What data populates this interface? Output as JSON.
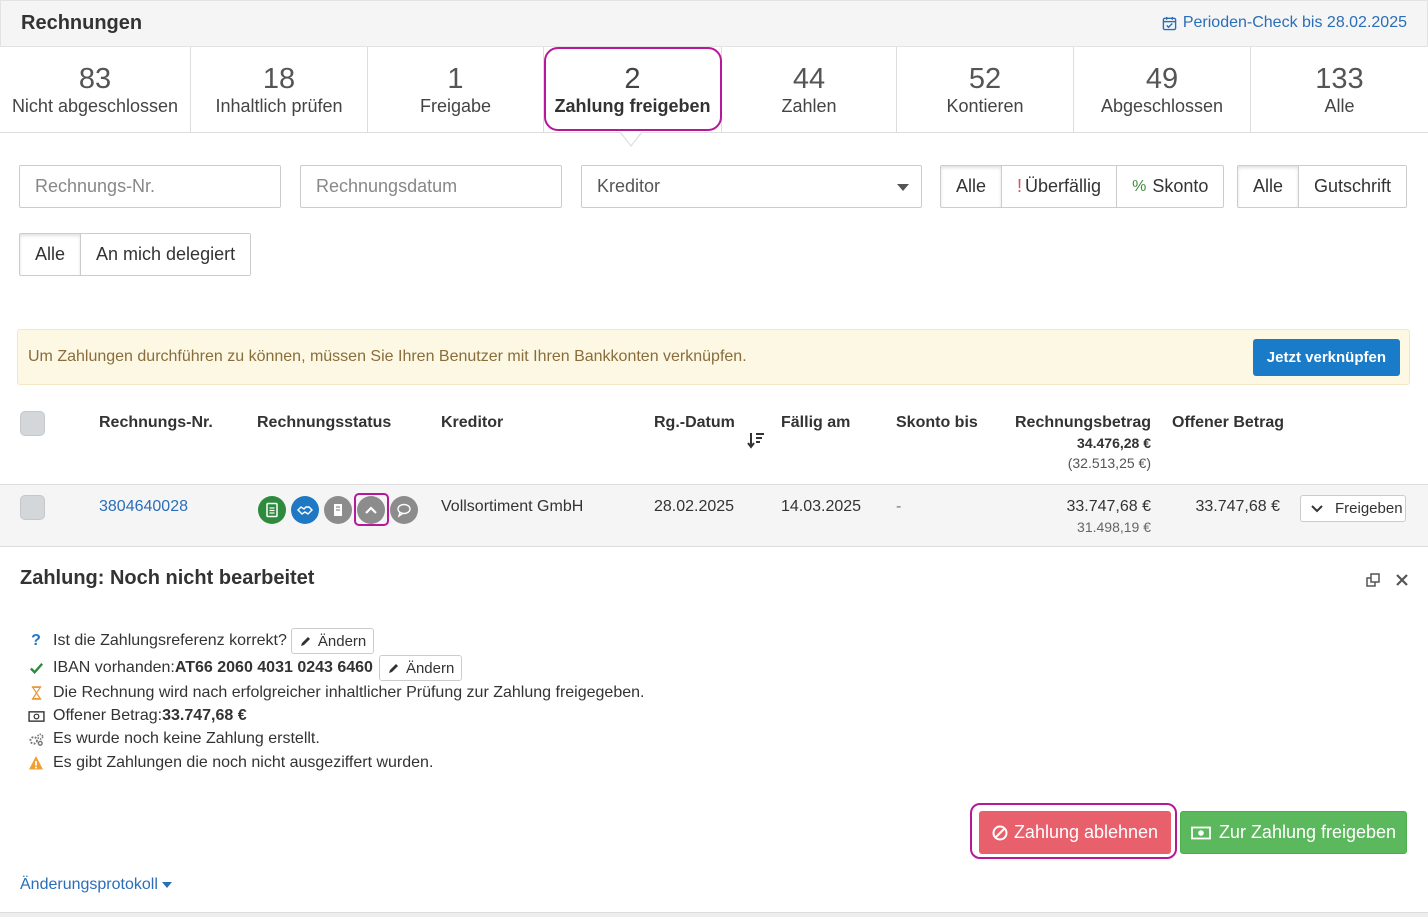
{
  "header": {
    "title": "Rechnungen",
    "period_check": "Perioden-Check bis 28.02.2025"
  },
  "tabs": [
    {
      "count": "83",
      "label": "Nicht abgeschlossen"
    },
    {
      "count": "18",
      "label": "Inhaltlich prüfen"
    },
    {
      "count": "1",
      "label": "Freigabe"
    },
    {
      "count": "2",
      "label": "Zahlung freigeben"
    },
    {
      "count": "44",
      "label": "Zahlen"
    },
    {
      "count": "52",
      "label": "Kontieren"
    },
    {
      "count": "49",
      "label": "Abgeschlossen"
    },
    {
      "count": "133",
      "label": "Alle"
    }
  ],
  "filters": {
    "invoice_no_placeholder": "Rechnungs-Nr.",
    "invoice_date_placeholder": "Rechnungsdatum",
    "creditor_select": "Kreditor",
    "due_group": [
      "Alle",
      "Überfällig",
      "Skonto"
    ],
    "type_group": [
      "Alle",
      "Gutschrift"
    ],
    "delegation_group": [
      "Alle",
      "An mich delegiert"
    ]
  },
  "alert": {
    "message": "Um Zahlungen durchführen zu können, müssen Sie Ihren Benutzer mit Ihren Bankkonten verknüpfen.",
    "button": "Jetzt verknüpfen"
  },
  "table": {
    "headers": {
      "invoice_no": "Rechnungs-Nr.",
      "status": "Rechnungsstatus",
      "creditor": "Kreditor",
      "date": "Rg.-Datum",
      "due": "Fällig am",
      "discount": "Skonto bis",
      "amount": "Rechnungsbetrag",
      "amount_total": "34.476,28 €",
      "amount_total_sub": "(32.513,25 €)",
      "open": "Offener Betrag"
    },
    "rows": [
      {
        "invoice_no": "3804640028",
        "creditor": "Vollsortiment GmbH",
        "date": "28.02.2025",
        "due": "14.03.2025",
        "discount": "-",
        "amount": "33.747,68 €",
        "amount_sub": "31.498,19 €",
        "open": "33.747,68 €",
        "action": "Freigeben"
      }
    ]
  },
  "detail": {
    "title": "Zahlung: Noch nicht bearbeitet",
    "lines": {
      "ref_question": "Ist die Zahlungsreferenz korrekt?",
      "iban_prefix": "IBAN vorhanden: ",
      "iban": "AT66 2060 4031 0243 6460",
      "pending": "Die Rechnung wird nach erfolgreicher inhaltlicher Prüfung zur Zahlung freigegeben.",
      "open_prefix": "Offener Betrag: ",
      "open_amount": "33.747,68 €",
      "no_payment": "Es wurde noch keine Zahlung erstellt.",
      "warning": "Es gibt Zahlungen die noch nicht ausgeziffert wurden."
    },
    "edit_label": "Ändern",
    "reject_button": "Zahlung ablehnen",
    "approve_button": "Zur Zahlung freigeben",
    "changelog": "Änderungsprotokoll"
  },
  "colors": {
    "link": "#2a6eb8",
    "highlight": "#b5199a",
    "reject": "#e8606b",
    "approve": "#5cb85c",
    "alert_bg": "#fcf8e3",
    "primary_btn": "#1a7bc8"
  }
}
